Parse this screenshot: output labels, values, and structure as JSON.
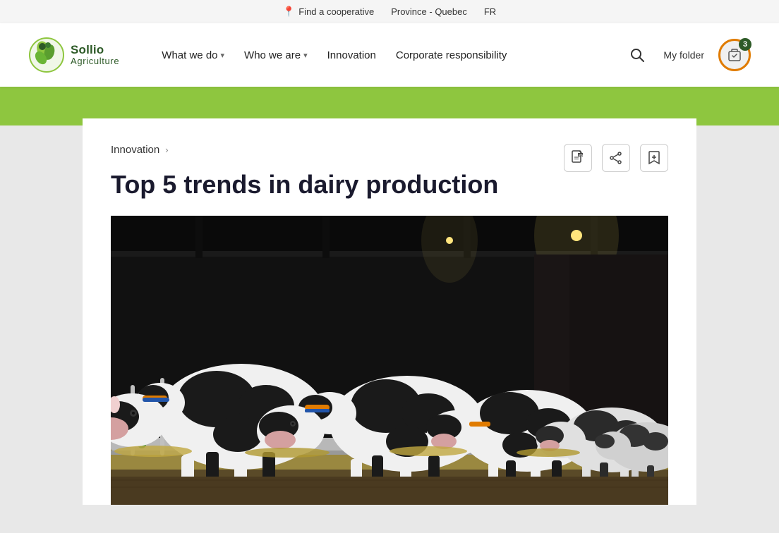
{
  "utility_bar": {
    "find_cooperative": "Find a cooperative",
    "province": "Province - Quebec",
    "language": "FR",
    "location_icon": "📍"
  },
  "nav": {
    "logo_brand": "Sollio",
    "logo_sub": "Agriculture",
    "links": [
      {
        "id": "what-we-do",
        "label": "What we do",
        "has_dropdown": true
      },
      {
        "id": "who-we-are",
        "label": "Who we are",
        "has_dropdown": true
      },
      {
        "id": "innovation",
        "label": "Innovation",
        "has_dropdown": false
      },
      {
        "id": "corporate-responsibility",
        "label": "Corporate responsibility",
        "has_dropdown": false
      }
    ],
    "search_label": "Search",
    "my_folder_label": "My folder",
    "bookmark_count": "3"
  },
  "content": {
    "breadcrumb_link": "Innovation",
    "page_title": "Top 5 trends in dairy production",
    "action_icons": {
      "pdf": "PDF",
      "share": "Share",
      "bookmark": "Bookmark"
    }
  }
}
